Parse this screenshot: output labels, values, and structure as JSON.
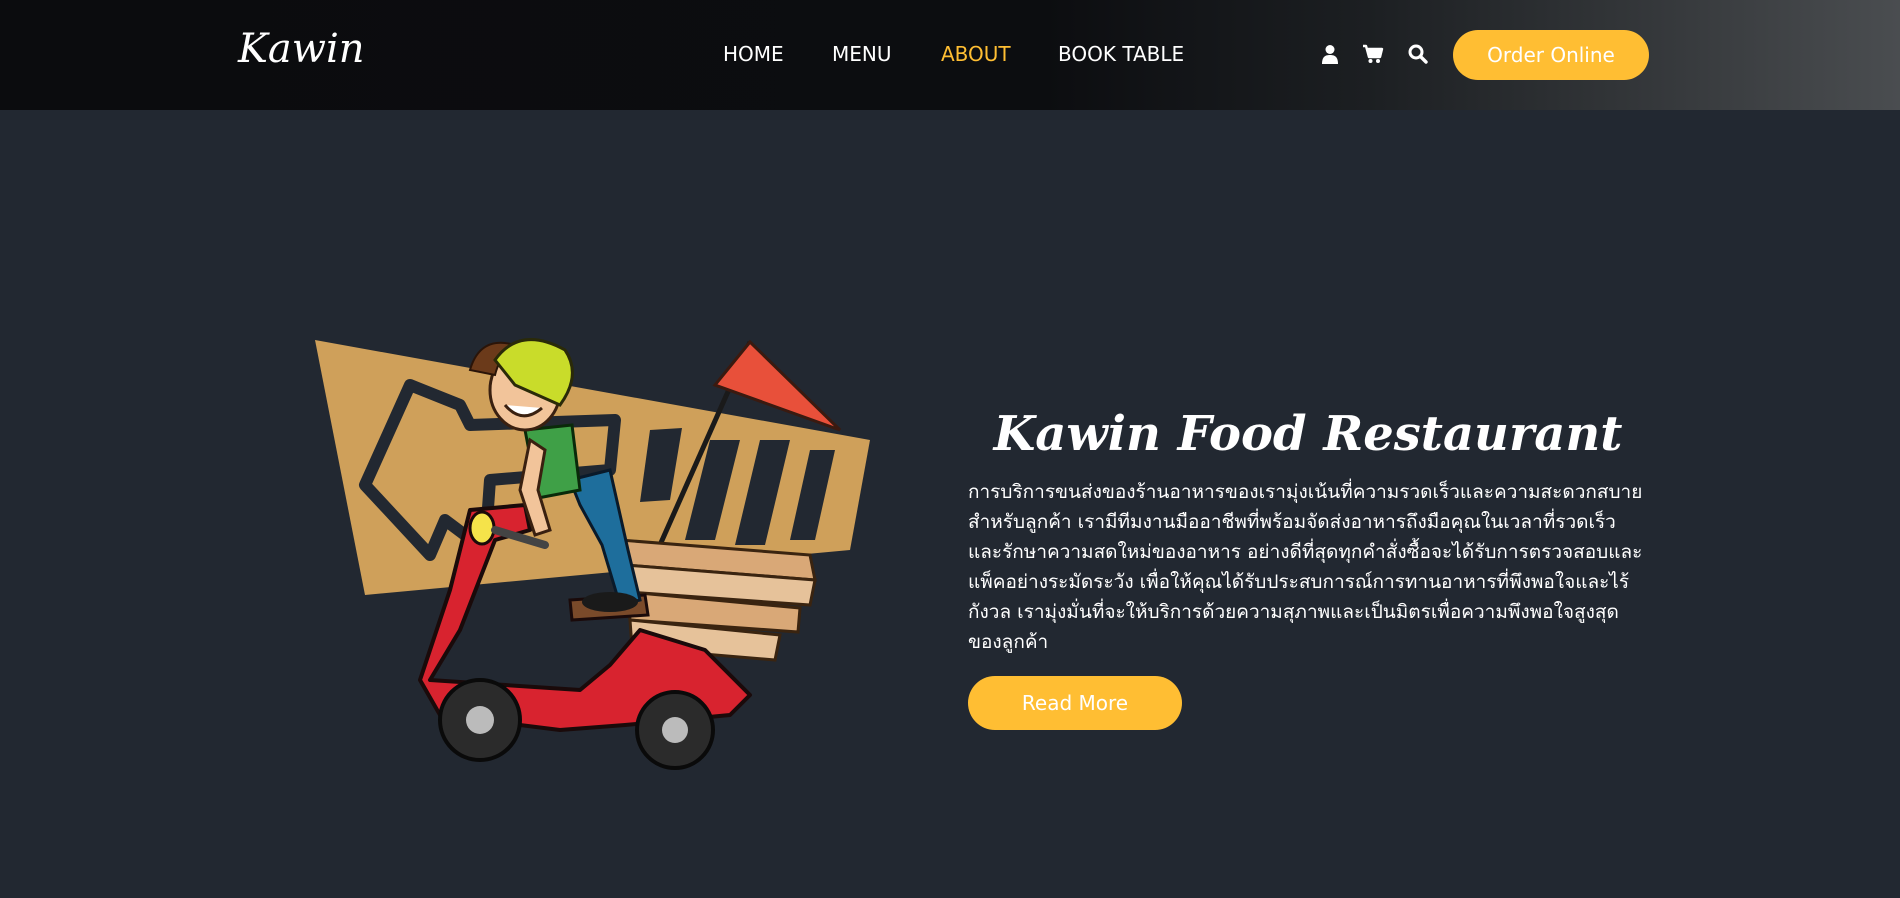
{
  "header": {
    "logo": "Kawin",
    "nav": [
      {
        "label": "HOME",
        "active": false
      },
      {
        "label": "MENU",
        "active": false
      },
      {
        "label": "ABOUT",
        "active": true
      },
      {
        "label": "BOOK TABLE",
        "active": false
      }
    ],
    "icons": [
      "user-icon",
      "cart-icon",
      "search-icon"
    ],
    "order_button": "Order Online"
  },
  "about": {
    "title": "Kawin Food Restaurant",
    "paragraph": "การบริการขนส่งของร้านอาหารของเรามุ่งเน้นที่ความรวดเร็วและความสะดวกสบายสำหรับลูกค้า เรามีทีมงานมืออาชีพที่พร้อมจัดส่งอาหารถึงมือคุณในเวลาที่รวดเร็วและรักษาความสดใหม่ของอาหาร อย่างดีที่สุดทุกคำสั่งซื้อจะได้รับการตรวจสอบและแพ็คอย่างระมัดระวัง เพื่อให้คุณได้รับประสบการณ์การทานอาหารที่พึงพอใจและไร้กังวล เรามุ่งมั่นที่จะให้บริการด้วยความสุภาพและเป็นมิตรเพื่อความพึงพอใจสูงสุดของลูกค้า",
    "read_more": "Read More"
  },
  "colors": {
    "accent": "#ffbe33",
    "background": "#222831",
    "header": "#0c0d10"
  }
}
